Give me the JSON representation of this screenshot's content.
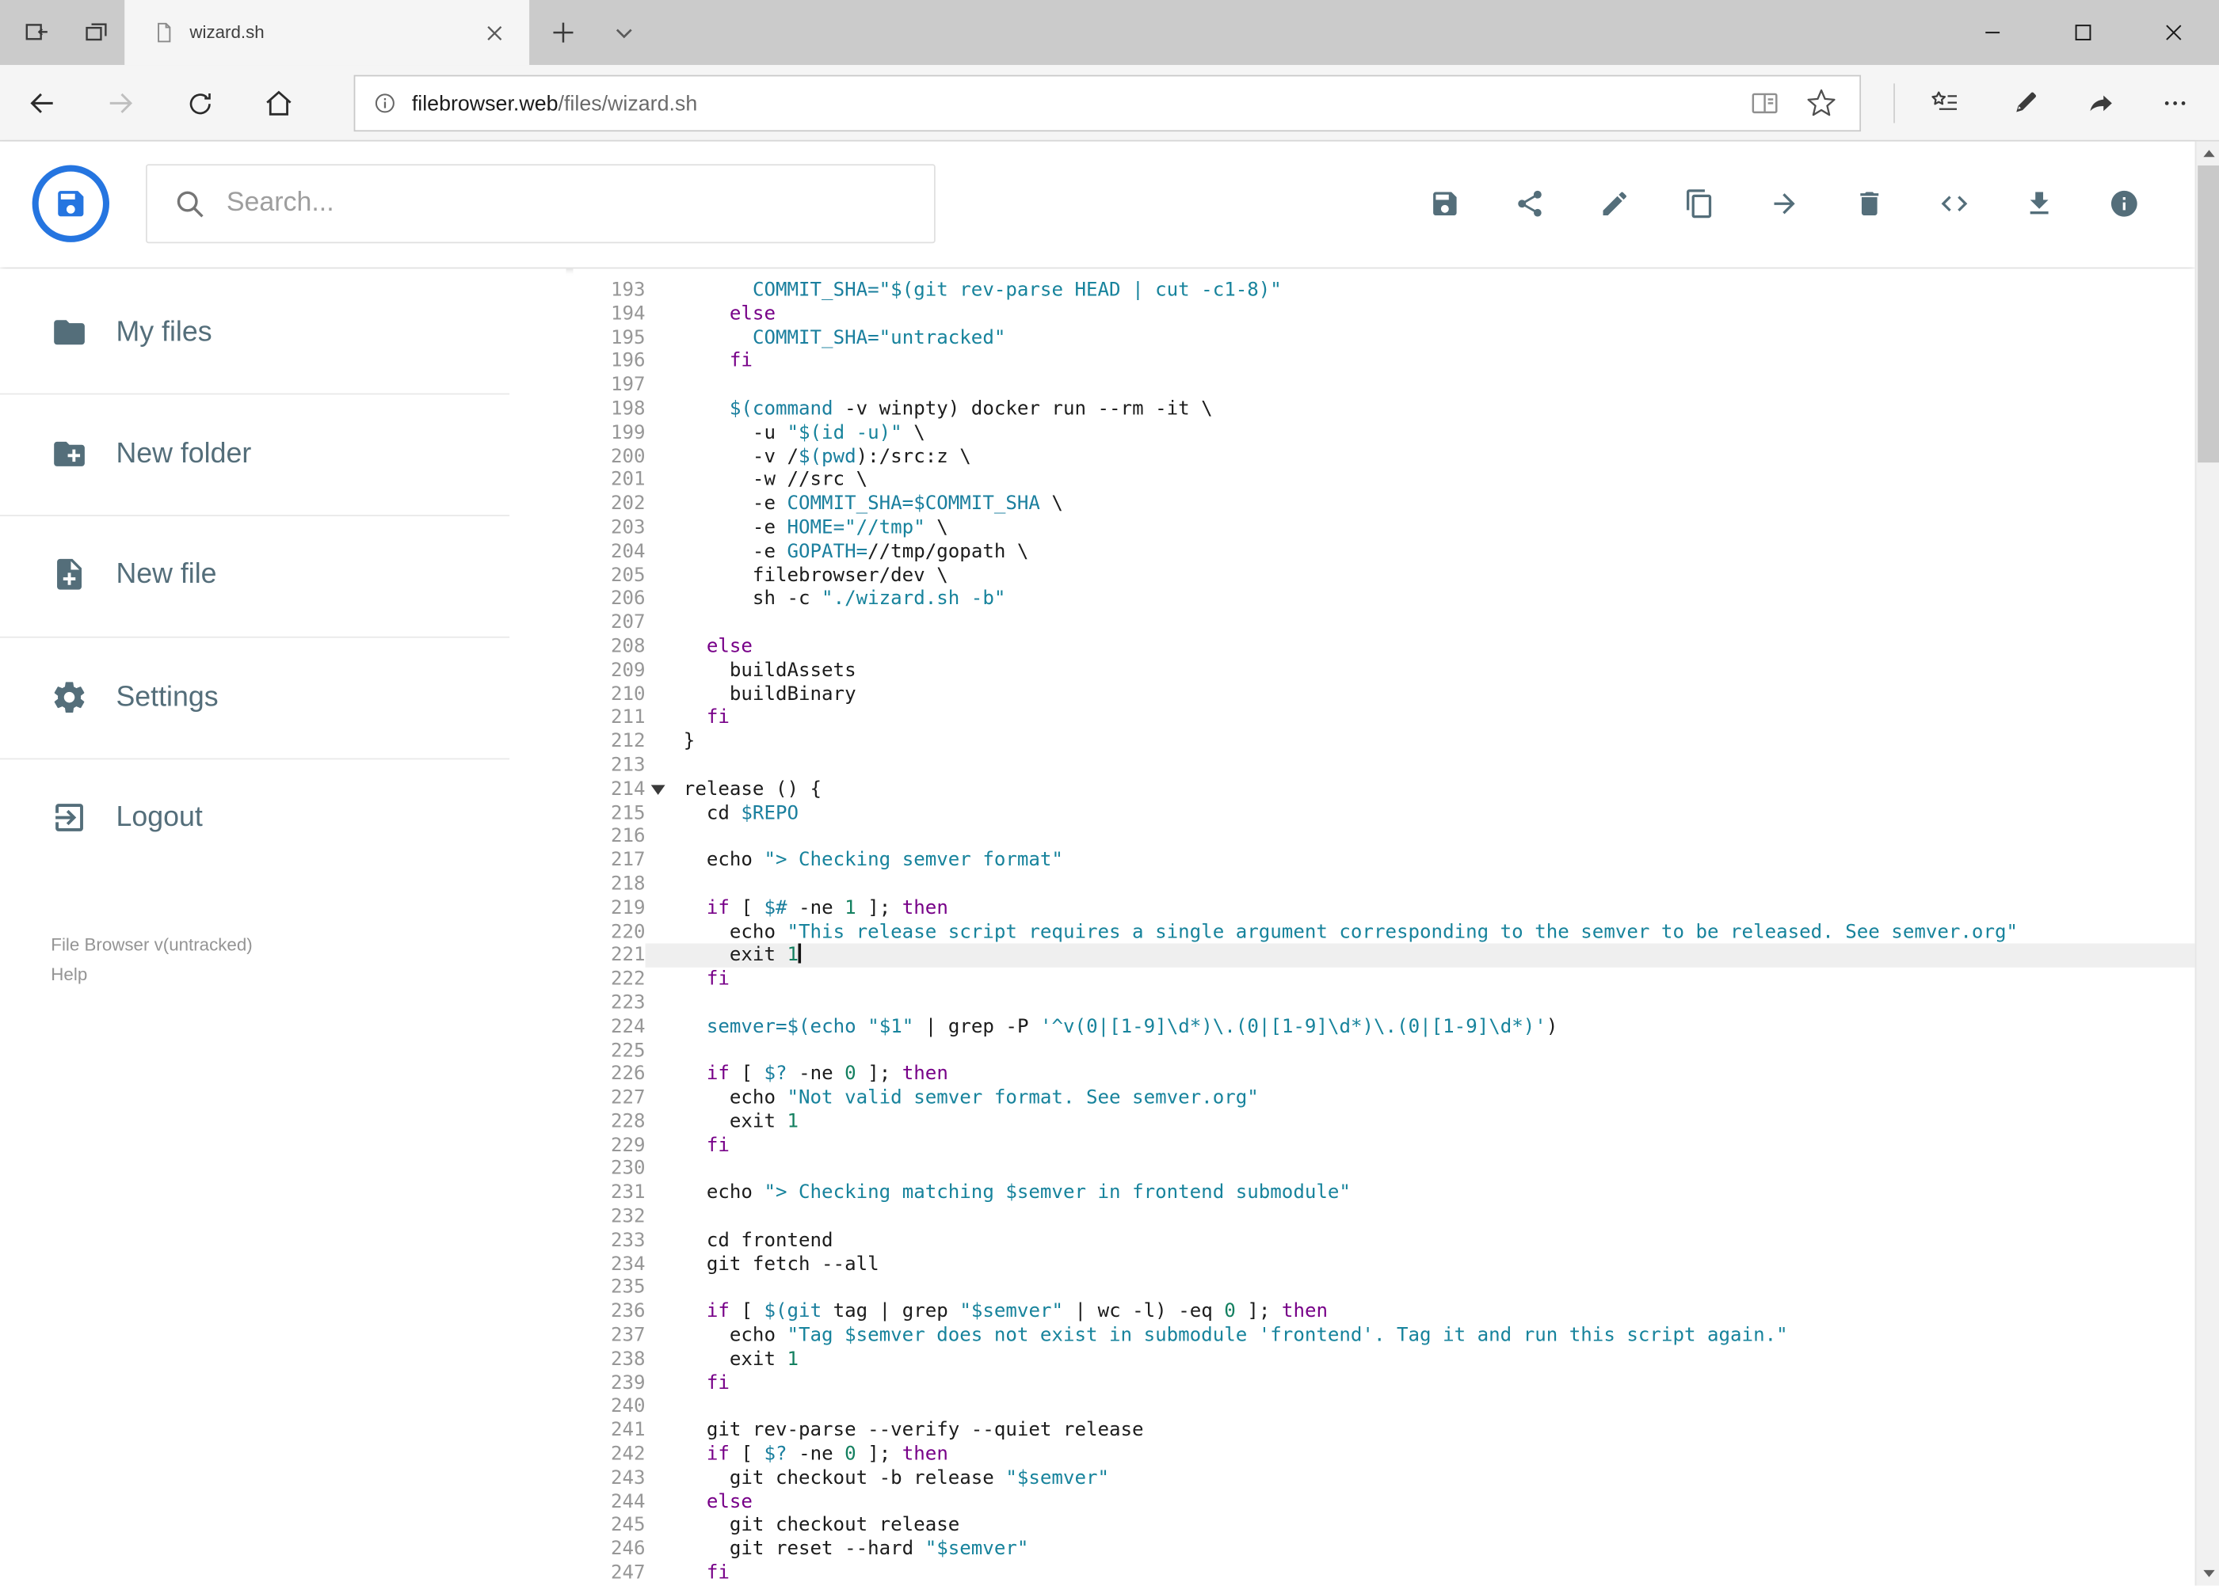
{
  "colors": {
    "brand_blue": "#2575e0",
    "toolbar_icon": "#546e7a",
    "sidebar_icon": "#546e7a",
    "syntax_string": "#17839c",
    "syntax_variable": "#1a7f9e",
    "syntax_keyword": "#770088",
    "syntax_number": "#148060",
    "active_line_bg": "#efefef"
  },
  "browser": {
    "tabstrip": {
      "left_icons": [
        "set-tabs-aside-icon",
        "tabs-preview-icon"
      ],
      "new_tab_icon": "plus-icon",
      "tab_menu_icon": "chevron-down-icon",
      "window_icons": [
        "minimize-icon",
        "maximize-icon",
        "close-icon"
      ]
    },
    "tab": {
      "title": "wizard.sh",
      "favicon": "document-icon",
      "close_icon": "close-icon"
    },
    "url": {
      "domain": "filebrowser.web",
      "path": "/files/wizard.sh",
      "page_icon": "info-icon"
    },
    "nav_icons": [
      "arrow-left-icon",
      "arrow-right-icon",
      "refresh-icon",
      "home-icon",
      "reading-view-icon",
      "star-icon",
      "hub-icon",
      "pen-icon",
      "share-icon",
      "ellipsis-icon"
    ]
  },
  "toolbar": {
    "search_placeholder": "Search...",
    "actions": [
      {
        "name": "save",
        "icon": "save-icon"
      },
      {
        "name": "share",
        "icon": "share-icon"
      },
      {
        "name": "edit",
        "icon": "pencil-icon"
      },
      {
        "name": "copy",
        "icon": "copy-icon"
      },
      {
        "name": "move",
        "icon": "arrow-forward-icon"
      },
      {
        "name": "delete",
        "icon": "trash-icon"
      },
      {
        "name": "raw-code",
        "icon": "code-icon"
      },
      {
        "name": "download",
        "icon": "download-icon"
      },
      {
        "name": "info",
        "icon": "info-circle-icon"
      }
    ]
  },
  "sidebar": {
    "items": [
      {
        "label": "My files",
        "icon": "folder-icon"
      },
      {
        "label": "New folder",
        "icon": "new-folder-icon"
      },
      {
        "label": "New file",
        "icon": "new-file-icon"
      },
      {
        "label": "Settings",
        "icon": "gear-icon"
      },
      {
        "label": "Logout",
        "icon": "logout-icon"
      }
    ],
    "footer": {
      "version": "File Browser v(untracked)",
      "help": "Help"
    }
  },
  "editor": {
    "language": "shell",
    "first_line": 193,
    "active_line": 221,
    "cursor_line": 221,
    "fold_marker_line": 214,
    "lines": [
      "      COMMIT_SHA=\"$(git rev-parse HEAD | cut -c1-8)\"",
      "    else",
      "      COMMIT_SHA=\"untracked\"",
      "    fi",
      "",
      "    $(command -v winpty) docker run --rm -it \\",
      "      -u \"$(id -u)\" \\",
      "      -v /$(pwd):/src:z \\",
      "      -w //src \\",
      "      -e COMMIT_SHA=$COMMIT_SHA \\",
      "      -e HOME=\"//tmp\" \\",
      "      -e GOPATH=//tmp/gopath \\",
      "      filebrowser/dev \\",
      "      sh -c \"./wizard.sh -b\"",
      "",
      "  else",
      "    buildAssets",
      "    buildBinary",
      "  fi",
      "}",
      "",
      "release () {",
      "  cd $REPO",
      "",
      "  echo \"> Checking semver format\"",
      "",
      "  if [ $# -ne 1 ]; then",
      "    echo \"This release script requires a single argument corresponding to the semver to be released. See semver.org\"",
      "    exit 1",
      "  fi",
      "",
      "  semver=$(echo \"$1\" | grep -P '^v(0|[1-9]\\d*)\\.(0|[1-9]\\d*)\\.(0|[1-9]\\d*)')",
      "",
      "  if [ $? -ne 0 ]; then",
      "    echo \"Not valid semver format. See semver.org\"",
      "    exit 1",
      "  fi",
      "",
      "  echo \"> Checking matching $semver in frontend submodule\"",
      "",
      "  cd frontend",
      "  git fetch --all",
      "",
      "  if [ $(git tag | grep \"$semver\" | wc -l) -eq 0 ]; then",
      "    echo \"Tag $semver does not exist in submodule 'frontend'. Tag it and run this script again.\"",
      "    exit 1",
      "  fi",
      "",
      "  git rev-parse --verify --quiet release",
      "  if [ $? -ne 0 ]; then",
      "    git checkout -b release \"$semver\"",
      "  else",
      "    git checkout release",
      "    git reset --hard \"$semver\"",
      "  fi"
    ]
  }
}
